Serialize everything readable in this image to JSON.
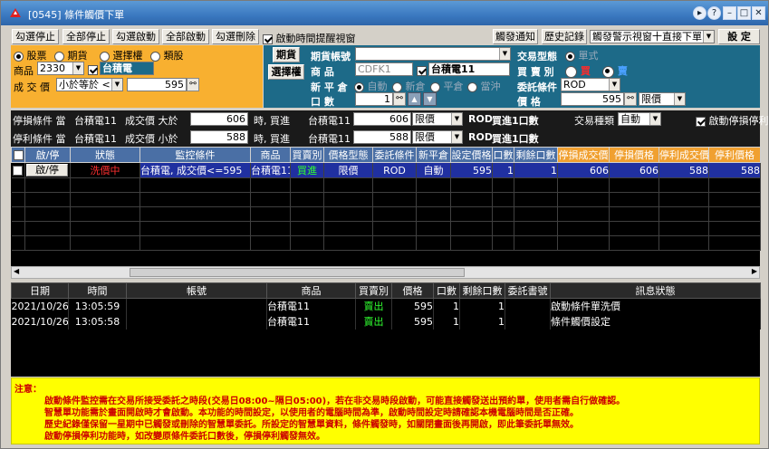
{
  "window": {
    "title": "[0545] 條件觸價下單"
  },
  "toolbar": {
    "buttons": [
      "勾選停止",
      "全部停止",
      "勾選啟動",
      "全部啟動",
      "勾選刪除"
    ],
    "reminder_label": "啟動時間提醒視窗",
    "notify_btn": "觸發通知",
    "history_btn": "歷史記錄",
    "trigger_mode": "觸發警示視窗十直接下單",
    "settings_btn": "設 定"
  },
  "left_panel": {
    "types": [
      "股票",
      "期貨",
      "選擇權",
      "類股"
    ],
    "product_label": "商品",
    "product_code": "2330",
    "product_name": "台積電",
    "price_label": "成 交 價",
    "compare_mode": "小於等於",
    "compare_op": "<=",
    "price_value": "595"
  },
  "right_panel": {
    "futures_btn": "期貨",
    "options_btn": "選擇權",
    "account_label": "期貨帳號",
    "product_label": "商 品",
    "product_code": "CDFK1",
    "product_name": "台積電11",
    "opencover_label": "新 平 倉",
    "opencover_opts": [
      "自動",
      "新倉",
      "平倉",
      "當沖"
    ],
    "qty_label": "口 數",
    "qty_value": "1",
    "trade_type_label": "交易型態",
    "trade_type_value": "單式",
    "side_label": "買 賣 別",
    "buy": "買",
    "sell": "賣",
    "order_cond_label": "委託條件",
    "order_cond_value": "ROD",
    "price_label": "價 格",
    "price_value": "595",
    "price_type": "限價"
  },
  "stop_loss": {
    "label": "停損條件 當",
    "product": "台積電11",
    "cond": "成交價 大於",
    "value": "606",
    "when": "時, 買進",
    "product2": "台積電11",
    "price": "606",
    "price_type": "限價",
    "rod": "ROD",
    "qty_text": "買進1口數",
    "trade_kind_label": "交易種類",
    "trade_kind_value": "自動",
    "enable_label": "啟動停損停利"
  },
  "take_profit": {
    "label": "停利條件 當",
    "product": "台積電11",
    "cond": "成交價 小於",
    "value": "588",
    "when": "時, 買進",
    "product2": "台積電11",
    "price": "588",
    "price_type": "限價",
    "rod": "ROD",
    "qty_text": "買進1口數"
  },
  "orders": {
    "headers": [
      "啟/停",
      "狀態",
      "監控條件",
      "商品",
      "買賣別",
      "價格型態",
      "委託條件",
      "新平倉",
      "設定價格",
      "口數",
      "剩餘口數",
      "停損成交價",
      "停損價格",
      "停利成交價",
      "停利價格"
    ],
    "rows": [
      {
        "action": "啟/停",
        "status": "洗價中",
        "condition": "台積電, 成交價<=595",
        "product": "台積電11",
        "side": "買進",
        "price_type": "限價",
        "order_cond": "ROD",
        "opencover": "自動",
        "price": "595",
        "qty": "1",
        "remain": "1",
        "sl_trade": "606",
        "sl_price": "606",
        "tp_trade": "588",
        "tp_price": "588"
      }
    ]
  },
  "log": {
    "headers": [
      "日期",
      "時間",
      "帳號",
      "商品",
      "買賣別",
      "價格",
      "口數",
      "剩餘口數",
      "委託書號",
      "訊息狀態"
    ],
    "rows": [
      {
        "date": "2021/10/26",
        "time": "13:05:59",
        "account": "",
        "product": "台積電11",
        "side": "賣出",
        "price": "595",
        "qty": "1",
        "remain": "1",
        "order_no": "",
        "message": "啟動條件單洗價"
      },
      {
        "date": "2021/10/26",
        "time": "13:05:58",
        "account": "",
        "product": "台積電11",
        "side": "賣出",
        "price": "595",
        "qty": "1",
        "remain": "1",
        "order_no": "",
        "message": "條件觸價設定"
      }
    ]
  },
  "notes": {
    "title": "注意：",
    "lines": [
      "啟動條件監控需在交易所接受委託之時段(交易日08:00~隔日05:00)，若在非交易時段啟動，可能直接觸發送出預約單，使用者需自行做確認。",
      "智慧單功能需於畫面開啟時才會啟動。本功能的時間設定，以使用者的電腦時間為準，啟動時間設定時請確認本機電腦時間是否正確。",
      "歷史紀錄僅保留一星期中已觸發或刪除的智慧單委託。所設定的智慧單資料，條件觸發時，如關閉畫面後再開啟，即此筆委託單無效。",
      "啟動停損停利功能時，如改變原條件委託口數後，停損停利觸發無效。"
    ]
  },
  "colors": {
    "title_bar": "#3a78c0",
    "orange_panel": "#f8b030",
    "blue_panel": "#1d6a88",
    "header_blue": "#4a6fa5",
    "header_orange": "#f0a030",
    "notes_bg": "#ffff00",
    "alert_red": "#ff2a2a"
  }
}
